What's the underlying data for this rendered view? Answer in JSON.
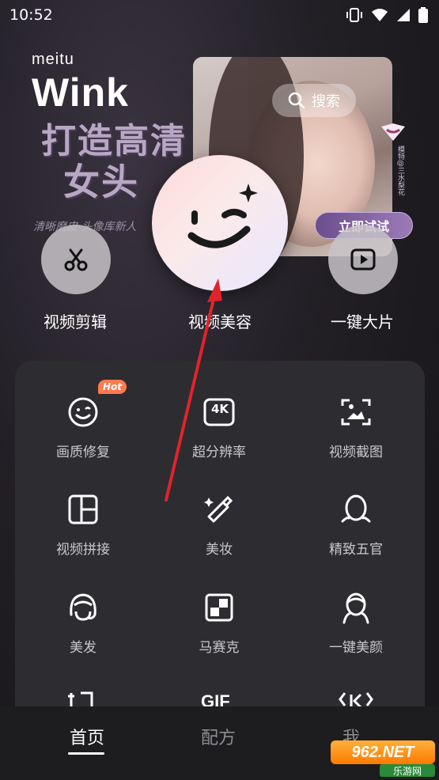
{
  "status_bar": {
    "time": "10:52",
    "icons": [
      "vibrate-icon",
      "wifi-icon",
      "signal-icon",
      "battery-icon"
    ]
  },
  "banner": {
    "brand_top": "meitu",
    "brand_main": "Wink",
    "title_line1": "打造高清",
    "title_line2": "女头",
    "subtitle": "清晰磨皮·头像库新人",
    "search_label": "搜索",
    "try_button": "立即试试",
    "side_text": "模特@三水梨花"
  },
  "features": [
    {
      "label": "视频剪辑",
      "icon": "scissors-icon"
    },
    {
      "label": "视频美容",
      "icon": "wink-face-icon"
    },
    {
      "label": "一键大片",
      "icon": "play-icon"
    }
  ],
  "tools": [
    {
      "label": "画质修复",
      "icon": "smile-face-icon",
      "badge": "Hot"
    },
    {
      "label": "超分辨率",
      "icon": "4k-icon",
      "icon_text": "4K"
    },
    {
      "label": "视频截图",
      "icon": "screenshot-icon"
    },
    {
      "label": "视频拼接",
      "icon": "layout-icon"
    },
    {
      "label": "美妆",
      "icon": "makeup-icon"
    },
    {
      "label": "精致五官",
      "icon": "face-outline-icon"
    },
    {
      "label": "美发",
      "icon": "hair-icon"
    },
    {
      "label": "马赛克",
      "icon": "mosaic-icon"
    },
    {
      "label": "一键美颜",
      "icon": "portrait-icon"
    }
  ],
  "partial_row": [
    "crop-icon",
    "gif-icon",
    "bracket-icon"
  ],
  "partial_row_text": {
    "gif": "GIF"
  },
  "bottom_nav": [
    {
      "label": "首页",
      "active": true
    },
    {
      "label": "配方",
      "active": false
    },
    {
      "label": "我",
      "active": false
    }
  ],
  "watermark": {
    "main": "962.NET",
    "sub": "乐游网"
  },
  "colors": {
    "accent_red": "#e0242a",
    "hot_badge": "#ff7a4f",
    "card_bg": "#2d2c30"
  }
}
